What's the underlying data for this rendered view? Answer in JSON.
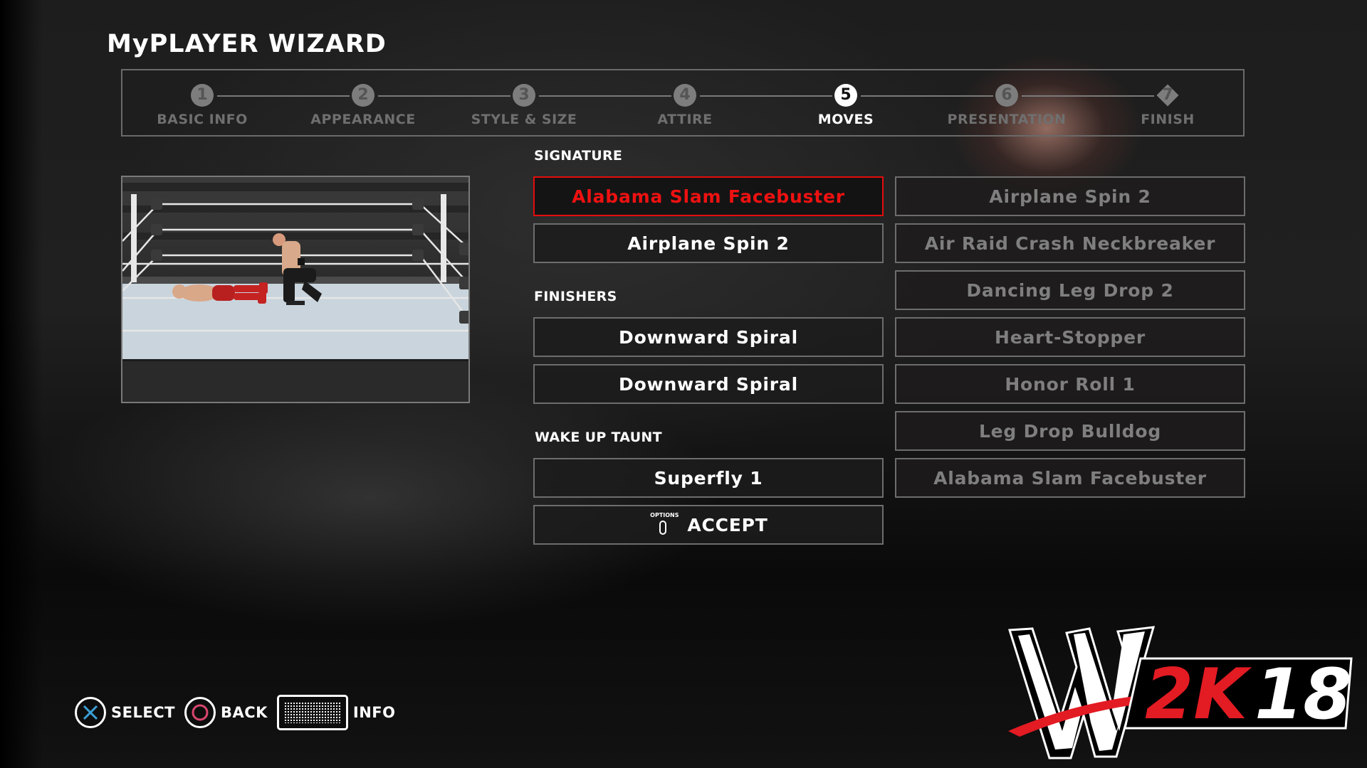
{
  "header": {
    "title": "MyPLAYER WIZARD"
  },
  "stepper": {
    "active_index": 4,
    "steps": [
      {
        "number": "1",
        "label": "BASIC INFO",
        "shape": "circle"
      },
      {
        "number": "2",
        "label": "APPEARANCE",
        "shape": "circle"
      },
      {
        "number": "3",
        "label": "STYLE & SIZE",
        "shape": "circle"
      },
      {
        "number": "4",
        "label": "ATTIRE",
        "shape": "circle"
      },
      {
        "number": "5",
        "label": "MOVES",
        "shape": "circle"
      },
      {
        "number": "6",
        "label": "PRESENTATION",
        "shape": "circle"
      },
      {
        "number": "7",
        "label": "FINISH",
        "shape": "diamond"
      }
    ]
  },
  "preview": {
    "description": "Move preview: wrestler kneeling beside downed opponent in ring"
  },
  "moves": {
    "signature_label": "SIGNATURE",
    "signature": [
      {
        "name": "Alabama Slam Facebuster",
        "selected": true
      },
      {
        "name": "Airplane Spin 2",
        "selected": false
      }
    ],
    "finishers_label": "FINISHERS",
    "finishers": [
      {
        "name": "Downward Spiral"
      },
      {
        "name": "Downward Spiral"
      }
    ],
    "wake_up_taunt_label": "WAKE UP TAUNT",
    "wake_up_taunt": {
      "name": "Superfly 1"
    },
    "accept": {
      "button_hint": "OPTIONS",
      "label": "ACCEPT"
    }
  },
  "options_list": [
    "Airplane Spin 2",
    "Air Raid Crash Neckbreaker",
    "Dancing Leg Drop 2",
    "Heart-Stopper",
    "Honor Roll 1",
    "Leg Drop Bulldog",
    "Alabama Slam Facebuster"
  ],
  "controls": {
    "select": {
      "icon": "cross-button-icon",
      "label": "SELECT"
    },
    "back": {
      "icon": "circle-button-icon",
      "label": "BACK"
    },
    "info": {
      "icon": "touchpad-icon",
      "label": "INFO"
    }
  },
  "logo": {
    "wordmark": "2K",
    "year": "18"
  },
  "colors": {
    "accent_red": "#e50c0c",
    "active_text": "#ffffff",
    "inactive_text": "#7f7f7f",
    "cross_blue": "#3a9fd6",
    "circle_pink": "#d9466e"
  }
}
